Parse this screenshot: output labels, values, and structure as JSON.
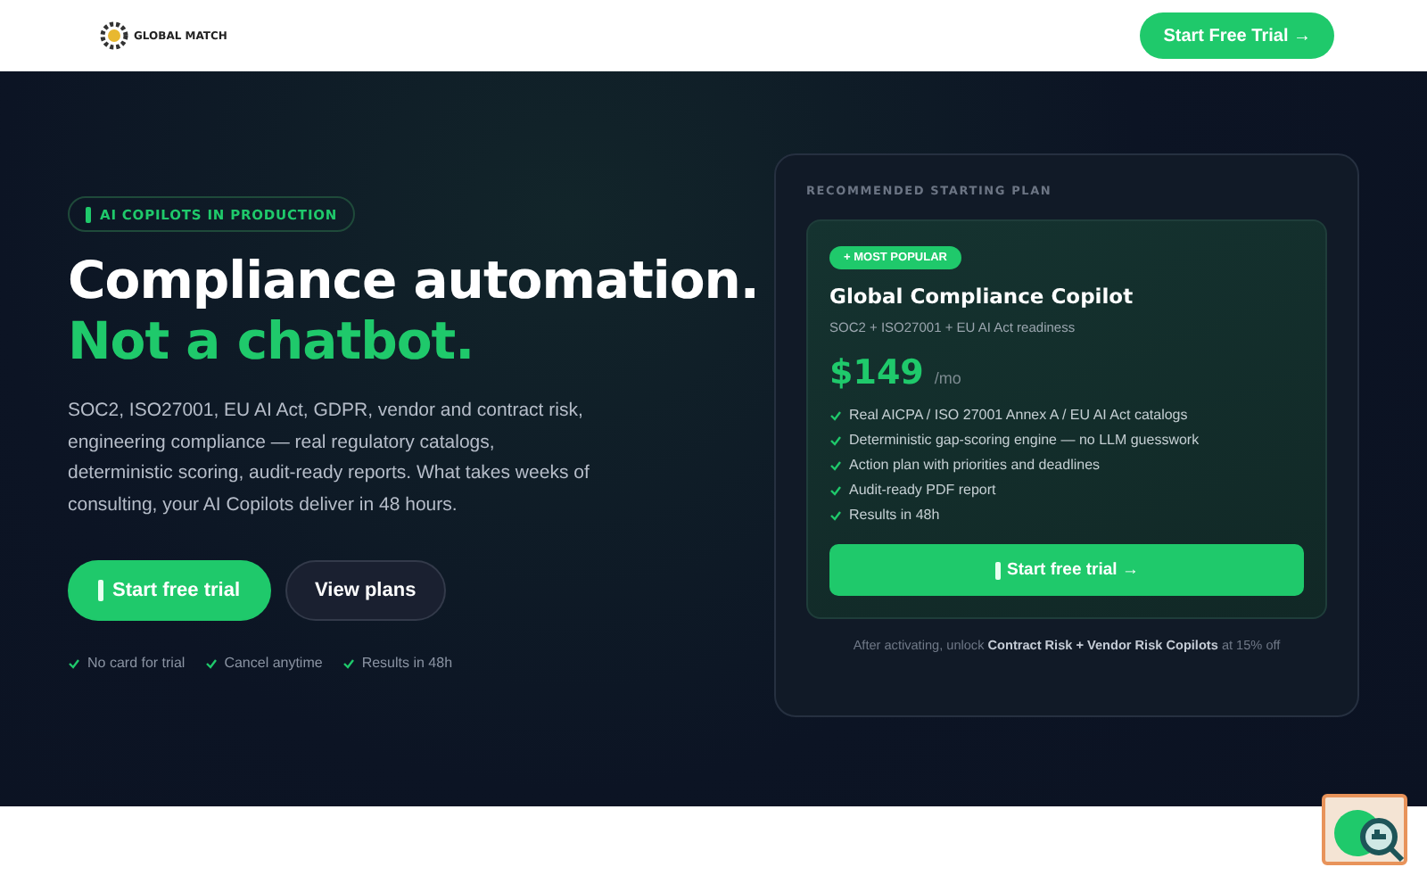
{
  "header": {
    "logo_text": "GLOBAL MATCH",
    "cta": "Start Free Trial →"
  },
  "hero": {
    "badge": "AI COPILOTS IN PRODUCTION",
    "title": "Compliance automation.",
    "title_accent": "Not a chatbot.",
    "description": "SOC2, ISO27001, EU AI Act, GDPR, vendor and contract risk, engineering compliance — real regulatory catalogs, deterministic scoring, audit-ready reports. What takes weeks of consulting, your AI Copilots deliver in 48 hours.",
    "buttons": [
      {
        "label": "Start free trial",
        "kind": "primary"
      },
      {
        "label": "View plans",
        "kind": "secondary"
      }
    ],
    "perks": [
      "No card for trial",
      "Cancel anytime",
      "Results in 48h"
    ]
  },
  "plan_panel": {
    "heading": "RECOMMENDED STARTING PLAN",
    "badge": "+ MOST POPULAR",
    "name": "Global Compliance Copilot",
    "subtitle": "SOC2 + ISO27001 + EU AI Act readiness",
    "price": "$149",
    "period": "/mo",
    "features": [
      "Real AICPA / ISO 27001 Annex A / EU AI Act catalogs",
      "Deterministic gap-scoring engine — no LLM guesswork",
      "Action plan with priorities and deadlines",
      "Audit-ready PDF report",
      "Results in 48h"
    ],
    "cta": "Start free trial →",
    "footnote": "After activating, unlock **Contract Risk + Vendor Risk Copilots** at 15% off"
  }
}
